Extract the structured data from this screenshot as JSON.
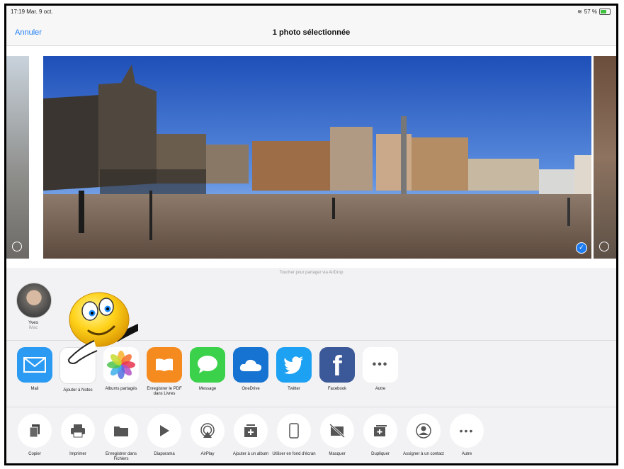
{
  "status": {
    "time": "17:19  Mar. 9 oct.",
    "battery": "57 %"
  },
  "nav": {
    "cancel": "Annuler",
    "title": "1 photo sélectionnée"
  },
  "airdrop": {
    "hint": "Toucher pour partager via AirDrop",
    "contact_name": "Yves",
    "contact_device": "iMac"
  },
  "apps": [
    {
      "label": "Mail",
      "icon": "mail-icon",
      "color": "#2b9af3"
    },
    {
      "label": "Ajouter à Notes",
      "icon": "notes-icon",
      "color": "#ffffff"
    },
    {
      "label": "Albums partagés",
      "icon": "photos-icon",
      "color": "#ffffff"
    },
    {
      "label": "Enregistrer le PDF dans Livres",
      "icon": "books-icon",
      "color": "#f58b1f"
    },
    {
      "label": "Message",
      "icon": "message-icon",
      "color": "#3bd14a"
    },
    {
      "label": "OneDrive",
      "icon": "onedrive-icon",
      "color": "#1673d1"
    },
    {
      "label": "Twitter",
      "icon": "twitter-icon",
      "color": "#1da1f2"
    },
    {
      "label": "Facebook",
      "icon": "facebook-icon",
      "color": "#3b5998"
    },
    {
      "label": "Autre",
      "icon": "more-icon",
      "color": "#ffffff"
    }
  ],
  "actions": [
    {
      "label": "Copier",
      "icon": "copy-icon"
    },
    {
      "label": "Imprimer",
      "icon": "print-icon"
    },
    {
      "label": "Enregistrer dans Fichiers",
      "icon": "folder-icon"
    },
    {
      "label": "Diaporama",
      "icon": "play-icon"
    },
    {
      "label": "AirPlay",
      "icon": "airplay-icon"
    },
    {
      "label": "Ajouter à un album",
      "icon": "add-album-icon"
    },
    {
      "label": "Utiliser en fond d'écran",
      "icon": "wallpaper-icon"
    },
    {
      "label": "Masquer",
      "icon": "hide-icon"
    },
    {
      "label": "Dupliquer",
      "icon": "duplicate-icon"
    },
    {
      "label": "Assigner à un contact",
      "icon": "contact-icon"
    },
    {
      "label": "Autre",
      "icon": "more-icon"
    }
  ]
}
